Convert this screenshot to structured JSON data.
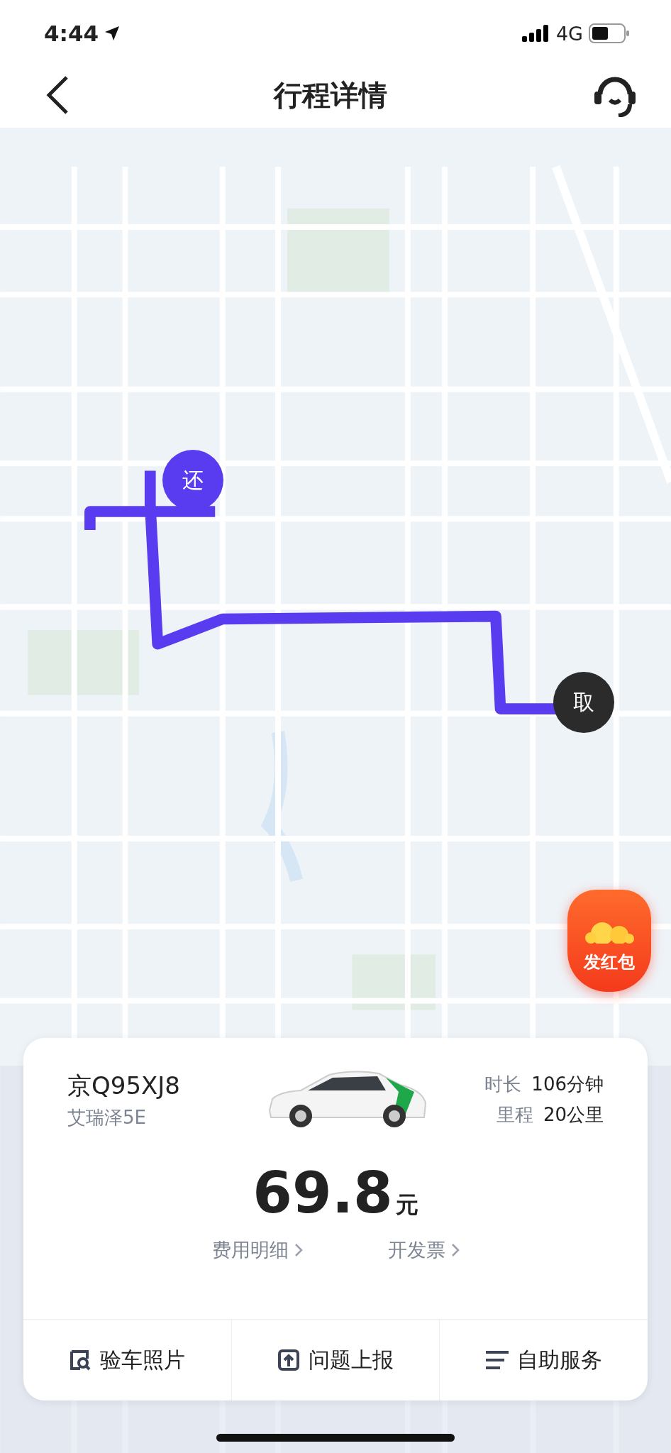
{
  "status_bar": {
    "time": "4:44",
    "network": "4G"
  },
  "header": {
    "title": "行程详情"
  },
  "map": {
    "markers": [
      {
        "kind": "return",
        "label": "还"
      },
      {
        "kind": "pickup",
        "label": "取"
      }
    ],
    "red_packet": {
      "label": "发红包"
    }
  },
  "trip": {
    "plate": "京Q95XJ8",
    "model": "艾瑞泽5E",
    "stats": [
      {
        "label": "时长",
        "value": "106分钟"
      },
      {
        "label": "里程",
        "value": "20公里"
      }
    ],
    "price": "69.8",
    "currency": "元",
    "links": [
      "费用明细",
      "开发票"
    ]
  },
  "actions": [
    {
      "kind": "photo",
      "label": "验车照片"
    },
    {
      "kind": "report",
      "label": "问题上报"
    },
    {
      "kind": "service",
      "label": "自助服务"
    }
  ]
}
